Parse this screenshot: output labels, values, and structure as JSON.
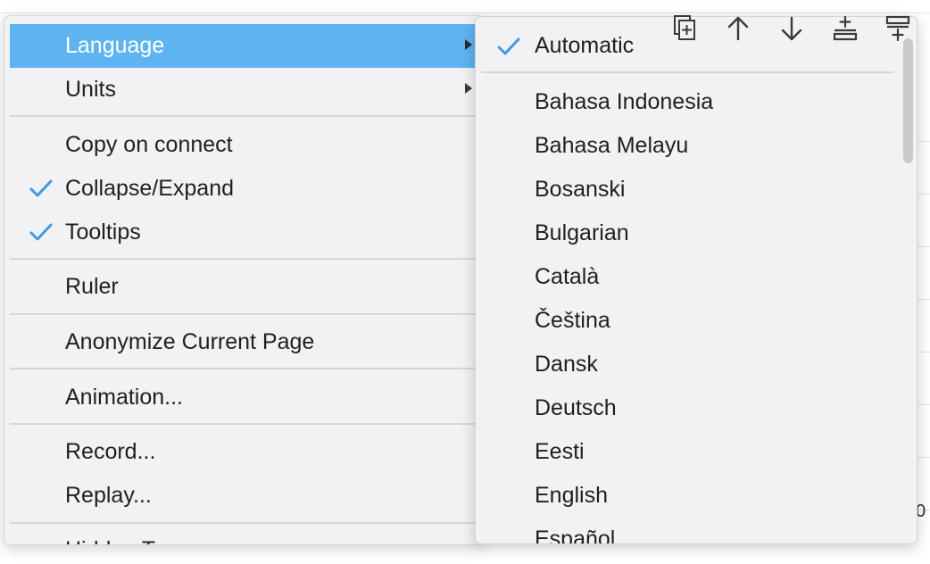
{
  "main_menu": {
    "items": [
      {
        "label": "Language",
        "checked": false,
        "submenu": true,
        "highlighted": true
      },
      {
        "label": "Units",
        "checked": false,
        "submenu": true
      },
      {
        "label": "Copy on connect",
        "checked": false
      },
      {
        "label": "Collapse/Expand",
        "checked": true
      },
      {
        "label": "Tooltips",
        "checked": true
      },
      {
        "label": "Ruler",
        "checked": false
      },
      {
        "label": "Anonymize Current Page",
        "checked": false
      },
      {
        "label": "Animation...",
        "checked": false
      },
      {
        "label": "Record...",
        "checked": false
      },
      {
        "label": "Replay...",
        "checked": false
      },
      {
        "label": "Hidden T...",
        "checked": false
      }
    ]
  },
  "language_submenu": {
    "selected": "Automatic",
    "items": [
      "Automatic",
      "Bahasa Indonesia",
      "Bahasa Melayu",
      "Bosanski",
      "Bulgarian",
      "Català",
      "Čeština",
      "Dansk",
      "Deutsch",
      "Eesti",
      "English",
      "Español"
    ]
  },
  "toolbar": {
    "icons": [
      "duplicate-icon",
      "arrow-up-icon",
      "arrow-down-icon",
      "insert-below-icon",
      "insert-row-icon"
    ]
  },
  "background": {
    "peek_text": "0"
  },
  "colors": {
    "highlight": "#5db4f0",
    "check": "#3b9be6",
    "menu_bg": "#f2f2f4"
  }
}
